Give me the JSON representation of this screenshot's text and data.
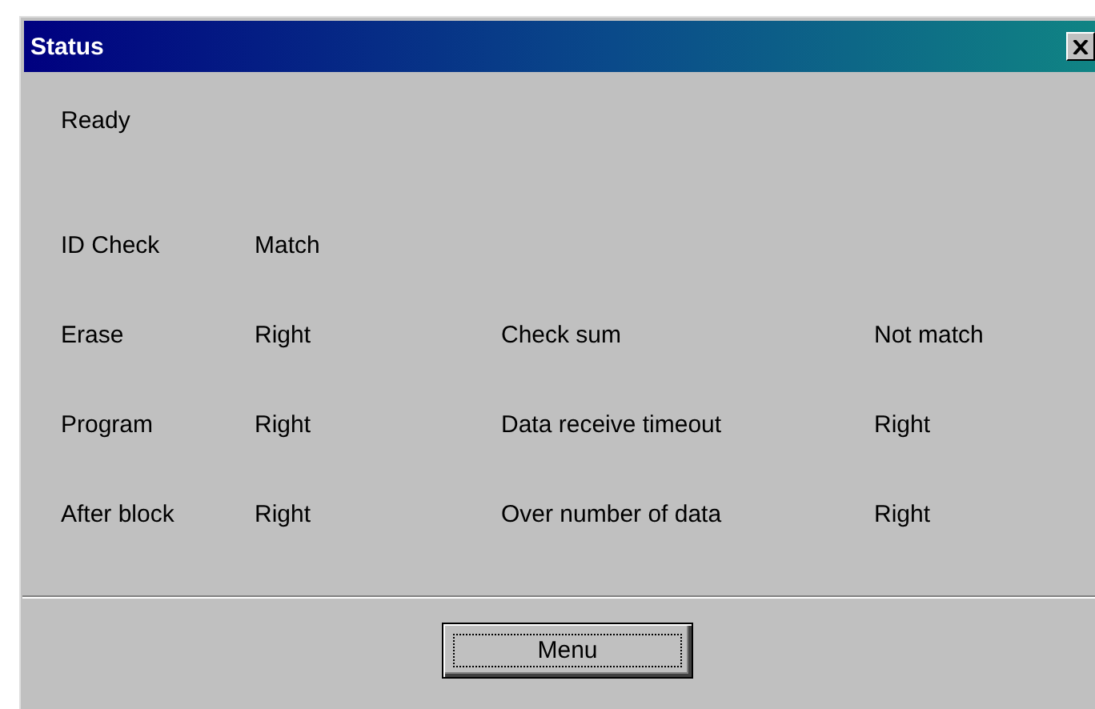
{
  "window": {
    "title": "Status"
  },
  "status": "Ready",
  "rows": [
    {
      "items": [
        {
          "label": "ID Check",
          "value": "Match"
        }
      ]
    },
    {
      "items": [
        {
          "label": "Erase",
          "value": "Right"
        },
        {
          "label": "Check sum",
          "value": "Not match"
        }
      ]
    },
    {
      "items": [
        {
          "label": "Program",
          "value": "Right"
        },
        {
          "label": "Data receive timeout",
          "value": "Right"
        }
      ]
    },
    {
      "items": [
        {
          "label": "After block",
          "value": "Right"
        },
        {
          "label": "Over number of data",
          "value": "Right"
        }
      ]
    }
  ],
  "buttons": [
    {
      "label": "Menu",
      "focused": true
    }
  ]
}
